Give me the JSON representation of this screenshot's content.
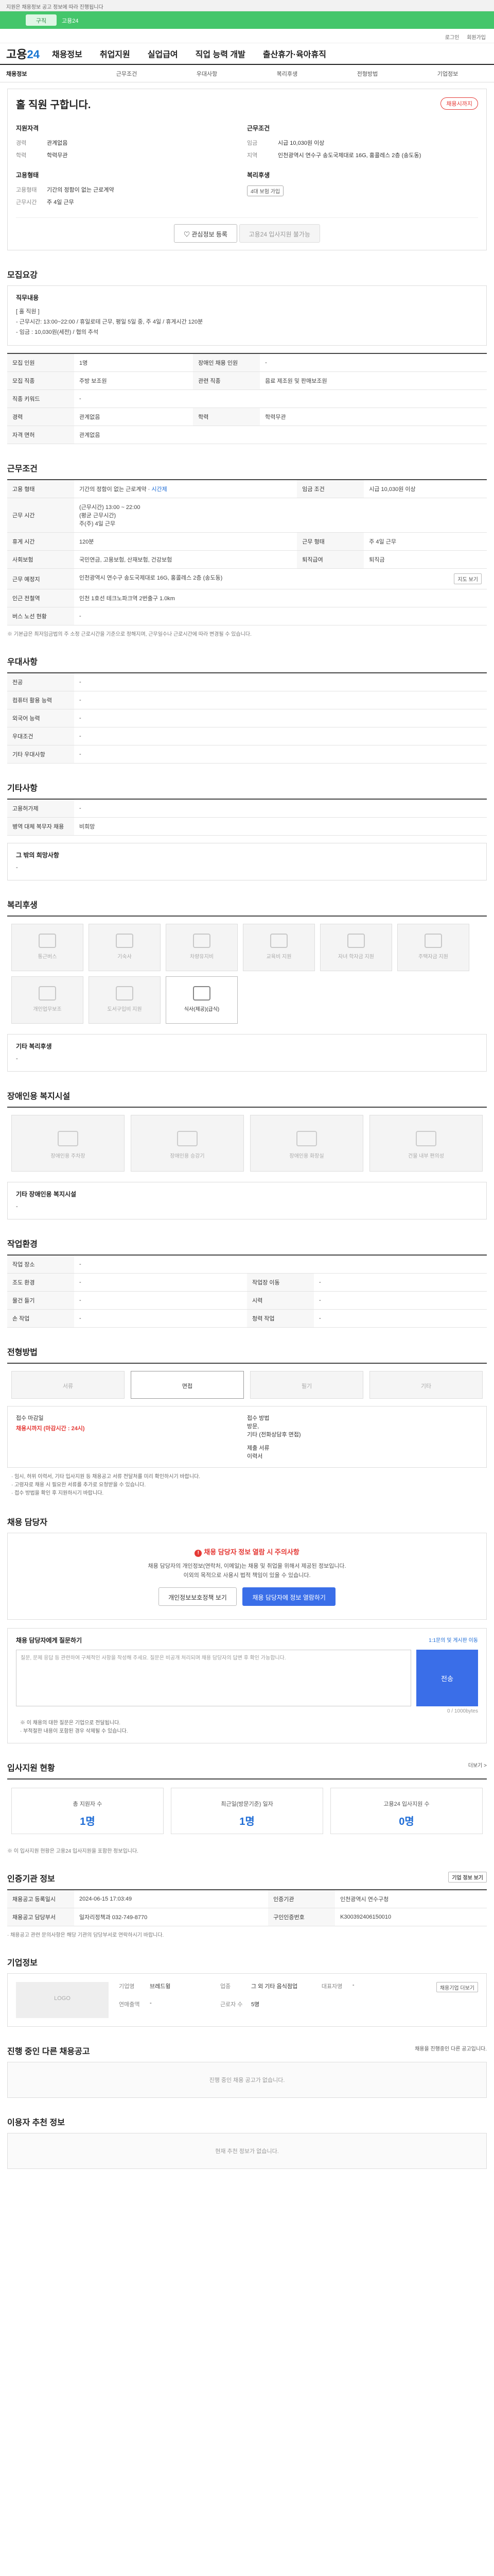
{
  "topbar": {
    "notice": "지원은 채용정보 공고 정보에 따라 진행됩니다",
    "tab_label": "구직",
    "tab_text": "고용24",
    "util": [
      "로그인",
      "회원가입"
    ]
  },
  "gnb": {
    "logo_text": "고용",
    "logo_num": "24",
    "menus": [
      "채용정보",
      "취업지원",
      "실업급여",
      "직업 능력 개발",
      "출산휴가·육아휴직"
    ]
  },
  "subnav": [
    "채용정보",
    "근무조건",
    "우대사항",
    "복리후생",
    "전형방법",
    "기업정보"
  ],
  "job": {
    "title": "홀 직원 구합니다.",
    "badge": "채용시까지",
    "cond_title": "지원자격",
    "career_k": "경력",
    "career_v": "관계없음",
    "edu_k": "학력",
    "edu_v": "학력무관",
    "work_title": "근무조건",
    "pay_k": "임금",
    "pay_v": "시급 10,030원 이상",
    "place_k": "지역",
    "place_v": "인천광역시 연수구 송도국제대로 16G, 홍콜레스 2층 (송도동)",
    "type_title": "고용형태",
    "type_k": "고용형태",
    "type_v": "기간의 정함이 없는 근로계약",
    "hours_k": "근무시간",
    "hours_v": "주 4일 근무",
    "welfare_title": "복리후생",
    "welfare_pills": [
      "4대 보험 가입"
    ],
    "save_btn": "관심정보 등록",
    "apply_btn": "고용24 입사지원 불가능"
  },
  "recruit": {
    "heading": "모집요강",
    "desc_title": "직무내용",
    "desc_lines": [
      "[ 홀 직원 ]",
      "- 근무시간: 13:00~22:00 / 휴일로테 근무, 평일 5일 중, 주 4일 / 휴게시간 120분",
      "- 임금 : 10,030원(세전) / 협의 추석"
    ],
    "rows": [
      {
        "k1": "모집 인원",
        "v1": "1명",
        "k2": "장애인 채용 인원",
        "v2": "-"
      },
      {
        "k1": "모집 직종",
        "v1": "주방 보조원",
        "k2": "관련 직종",
        "v2": "음료 제조원 및 판매보조원"
      },
      {
        "k1": "직종 키워드",
        "v1": "-",
        "k2": "",
        "v2": ""
      },
      {
        "k1": "경력",
        "v1": "관계없음",
        "k2": "학력",
        "v2": "학력무관"
      },
      {
        "k1": "자격 면허",
        "v1": "관계없음",
        "k2": "",
        "v2": ""
      }
    ]
  },
  "work": {
    "heading": "근무조건",
    "rows": [
      {
        "k": "고용 형태",
        "v": "기간의 정함이 없는 근로계약",
        "extra": "시간제",
        "k2": "임금 조건",
        "v2": "시급 10,030원 이상"
      },
      {
        "k": "근무 시간",
        "v": "(근무시간) 13:00 ~ 22:00\n(평균 근무시간)\n주(주) 4일 근무",
        "k2": "",
        "v2": ""
      },
      {
        "k": "휴게 시간",
        "v": "120분",
        "k2": "근무 형태",
        "v2": "주 4일 근무"
      },
      {
        "k": "사회보험",
        "v": "국민연금, 고용보험, 산재보험, 건강보험",
        "k2": "퇴직급여",
        "v2": "퇴직금"
      },
      {
        "k": "근무 예정지",
        "v": "인천광역시 연수구 송도국제대로 16G, 홍콜레스 2층 (송도동)",
        "k2": "",
        "v2": "",
        "btn": "지도 보기"
      },
      {
        "k": "인근 전철역",
        "v": "인천 1호선 테크노파크역 2번출구 1.0km",
        "k2": "",
        "v2": ""
      },
      {
        "k": "버스 노선 현황",
        "v": "-",
        "k2": "",
        "v2": ""
      }
    ],
    "note": "※ 기본급은 최저임금법의 주 소정 근로시간을 기준으로 정해지며, 근무일수나 근로시간에 따라 변경될 수 있습니다."
  },
  "pref": {
    "heading": "우대사항",
    "rows": [
      {
        "k": "전공",
        "v": "-"
      },
      {
        "k": "컴퓨터 활용 능력",
        "v": "-"
      },
      {
        "k": "외국어 능력",
        "v": "-"
      },
      {
        "k": "우대조건",
        "v": "-"
      },
      {
        "k": "기타 우대사항",
        "v": "-"
      }
    ]
  },
  "etc": {
    "heading": "기타사항",
    "rows": [
      {
        "k": "고용허가제",
        "v": "-"
      },
      {
        "k": "병역 대체 복무자 채용",
        "v": "비희망"
      }
    ],
    "memo_title": "그 밖의 희망사항",
    "memo_value": "-"
  },
  "welfare": {
    "heading": "복리후생",
    "items": [
      "통근버스",
      "기숙사",
      "차량유지비",
      "교육비 지원",
      "자녀 학자금 지원",
      "주택자금 지원",
      "개인업무보조",
      "도서구입비 지원",
      "식사(제공)(급식)"
    ],
    "active": "식사(제공)(급식)",
    "etc_title": "기타 복리후생",
    "etc_value": "-"
  },
  "disability": {
    "heading": "장애인용 복지시설",
    "items": [
      "장애인용 주차장",
      "장애인용 승강기",
      "장애인용 화장실",
      "건물 내부 편의성"
    ],
    "etc_title": "기타 장애인용 복지시설",
    "etc_value": "-"
  },
  "env": {
    "heading": "작업환경",
    "rows": [
      {
        "k1": "작업 장소",
        "v1": "-",
        "k2": "",
        "v2": ""
      },
      {
        "k1": "조도 환경",
        "v1": "-",
        "k2": "작업장 이동",
        "v2": "-"
      },
      {
        "k1": "물건 들기",
        "v1": "-",
        "k2": "시력",
        "v2": "-"
      },
      {
        "k1": "손 작업",
        "v1": "-",
        "k2": "청력 작업",
        "v2": "-"
      }
    ]
  },
  "screening": {
    "heading": "전형방법",
    "methods": [
      "서류",
      "면접",
      "필기",
      "기타"
    ],
    "active": "면접",
    "deadline_label": "접수 마감일",
    "deadline_value": "채용시까지 (마감시간 : 24시)",
    "method_label": "접수 방법",
    "method_value": "방문,",
    "method_sub": "기타 (전화상담후 면접)",
    "docs_label": "제출 서류",
    "docs_value": "이력서",
    "bullets": [
      "· 임시, 허위 이력서, 기타 입사지원 등 채용공고 서류 전달처를 미리 확인하시기 바랍니다.",
      "· 고령자로 채용 시 필요한 서류를 추가로 요청받을 수 있습니다.",
      "· 접수 방법을 확인 후 지원하시기 바랍니다."
    ]
  },
  "contact": {
    "heading": "채용 담당자",
    "warn": "채용 담당자 정보 열람 시 주의사항",
    "msg1": "채용 담당자의 개인정보(연락처, 이메일)는 채용 및 취업을 위해서 제공된 정보입니다.",
    "msg2": "이외의 목적으로 사용시 법적 책임이 있을 수 있습니다.",
    "btn_personal": "개인정보보호정책 보기",
    "btn_view": "채용 담당자에 정보 열람하기",
    "qa_title": "채용 담당자에게 질문하기",
    "qa_hint": "1:1문의 및 게시판 이동",
    "qa_placeholder": "질문, 문제 응답 등 관련하여 구체적인 사항을 작성해 주세요. 질문은 비공개 처리되며 채용 담당자의 답변 후 확인 가능합니다.",
    "qa_send": "전송",
    "qa_count": "0 / 1000bytes",
    "qa_notes": [
      "※ 이 채용의 대한 질문은 기업으로 전달됩니다.",
      "· 부적절한 내용이 포함된 경우 삭제될 수 있습니다."
    ]
  },
  "apply_stats": {
    "heading": "입사지원 현황",
    "more": "더보기 >",
    "items": [
      {
        "label": "총 지원자 수",
        "value": "1명"
      },
      {
        "label": "최근일(방문기준) 일자",
        "value": "1명"
      },
      {
        "label": "고용24 입사지원 수",
        "value": "0명"
      }
    ],
    "note": "※ 이 입사지원 현황은 고용24 입사지원을 포함한 정보입니다."
  },
  "auth": {
    "heading": "인증기관 정보",
    "btn": "기업 정보 보기",
    "rows": [
      {
        "k1": "채용공고 등록일시",
        "v1": "2024-06-15 17:03:49",
        "k2": "인증기관",
        "v2": "인천광역시 연수구청"
      },
      {
        "k1": "채용공고 담당부서",
        "v1": "일자리정책과 032-749-8770",
        "k2": "구인인증번호",
        "v2": "K300392406150010"
      }
    ],
    "note": "· 채용공고 관련 문의사항은 해당 기관의 담당부서로 연락하시기 바랍니다."
  },
  "company": {
    "heading": "기업정보",
    "logo": "LOGO",
    "btn": "채용기업 더보기",
    "rows": [
      {
        "k": "기업명",
        "v": "브레드윙"
      },
      {
        "k": "업종",
        "v": "그 외 기타 음식점업"
      },
      {
        "k": "대표자명",
        "v": "-"
      },
      {
        "k": "연매출액",
        "v": "-"
      },
      {
        "k": "근로자 수",
        "v": "5명"
      }
    ]
  },
  "other_jobs": {
    "heading": "진행 중인 다른 채용공고",
    "right": "채용을 진행중인 다른 공고입니다.",
    "empty": "진행 중인 채용 공고가 없습니다."
  },
  "recommend": {
    "heading": "이용자 추천 정보",
    "empty": "현재 추천 정보가 없습니다."
  }
}
